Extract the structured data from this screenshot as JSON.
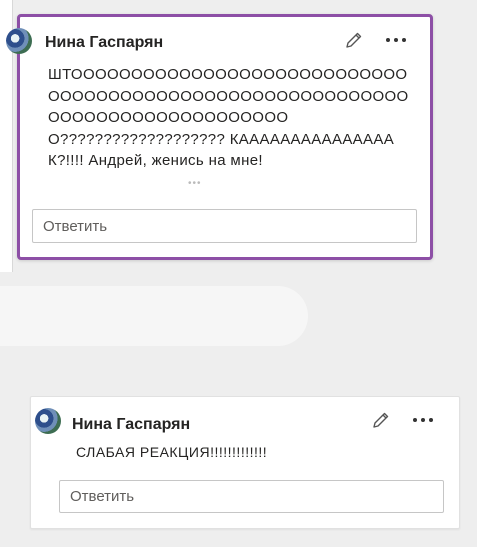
{
  "comments": [
    {
      "author": "Нина Гаспарян",
      "text": "ШТООООООООООООООООООООООООООООООООООООООООООООООООООООООООООООООООООООООООООООООО??????????????????? КАААААААААААААААК?!!!! Андрей, женись на мне!",
      "reply_placeholder": "Ответить",
      "icons": {
        "avatar": "avatar",
        "edit": "pencil-icon",
        "more": "more-options-icon"
      }
    },
    {
      "author": "Нина Гаспарян",
      "text": "СЛАБАЯ РЕАКЦИЯ!!!!!!!!!!!!!",
      "reply_placeholder": "Ответить",
      "icons": {
        "avatar": "avatar",
        "edit": "pencil-icon",
        "more": "more-options-icon"
      }
    }
  ],
  "colors": {
    "highlight_border": "#8d4fa6",
    "background": "#eeeeee",
    "text": "#252423",
    "placeholder": "#605e5c"
  }
}
